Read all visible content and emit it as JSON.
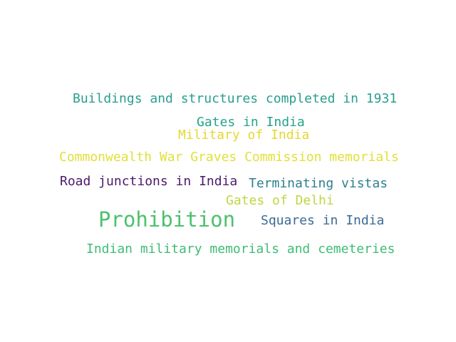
{
  "words": [
    {
      "id": "w-buildings",
      "text": "Buildings and structures completed in 1931",
      "color": "#2a9d8f"
    },
    {
      "id": "w-gates-india",
      "text": "Gates in India",
      "color": "#25a38a"
    },
    {
      "id": "w-military-india",
      "text": "Military of India",
      "color": "#e6d733"
    },
    {
      "id": "w-cwgc",
      "text": "Commonwealth War Graves Commission memorials",
      "color": "#e1e03a"
    },
    {
      "id": "w-road",
      "text": "Road junctions in India",
      "color": "#4b1a6b"
    },
    {
      "id": "w-vistas",
      "text": "Terminating vistas",
      "color": "#2e7f8e"
    },
    {
      "id": "w-gates-delhi",
      "text": "Gates of Delhi",
      "color": "#bcd843"
    },
    {
      "id": "w-prohibition",
      "text": "Prohibition",
      "color": "#4cc16d"
    },
    {
      "id": "w-squares",
      "text": "Squares in India",
      "color": "#3b6a93"
    },
    {
      "id": "w-memorials",
      "text": "Indian military memorials and cemeteries",
      "color": "#3fbc76"
    }
  ]
}
